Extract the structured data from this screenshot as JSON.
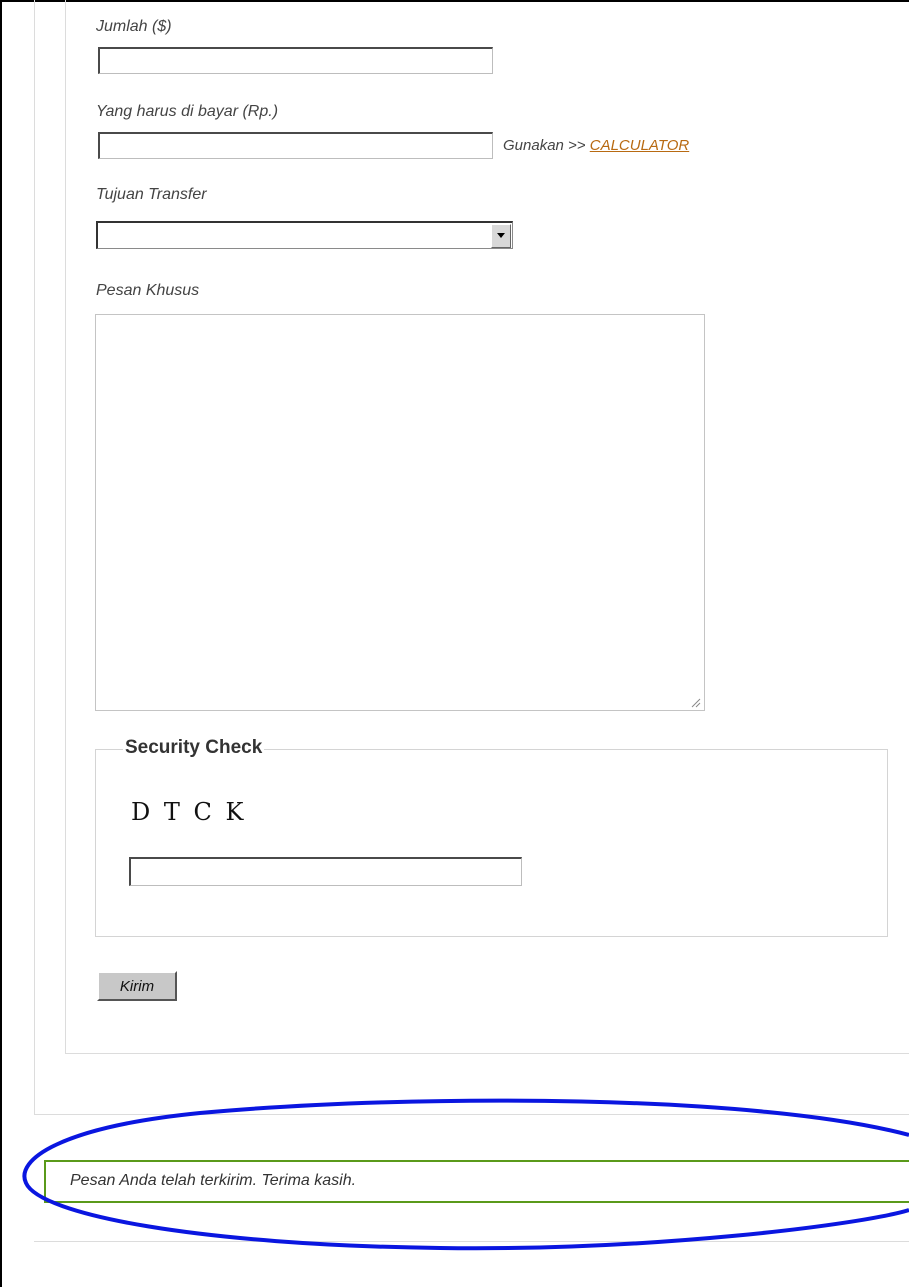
{
  "form": {
    "amount_label": "Jumlah ($)",
    "amount_value": "",
    "pay_label": "Yang harus di bayar (Rp.)",
    "pay_value": "",
    "calc_prefix": "Gunakan >>",
    "calc_link": "CALCULATOR",
    "transfer_label": "Tujuan Transfer",
    "transfer_value": "",
    "message_label": "Pesan Khusus",
    "message_value": ""
  },
  "security": {
    "legend": "Security Check",
    "captcha": "D T C K",
    "input_value": ""
  },
  "submit_label": "Kirim",
  "success_message": "Pesan Anda telah terkirim. Terima kasih.",
  "icons": {
    "dropdown": "triangle-down-icon",
    "resize": "resize-grip-icon"
  },
  "colors": {
    "link": "#b86a12",
    "success_border": "#5a9a1a",
    "annotation": "#0a16e0"
  }
}
